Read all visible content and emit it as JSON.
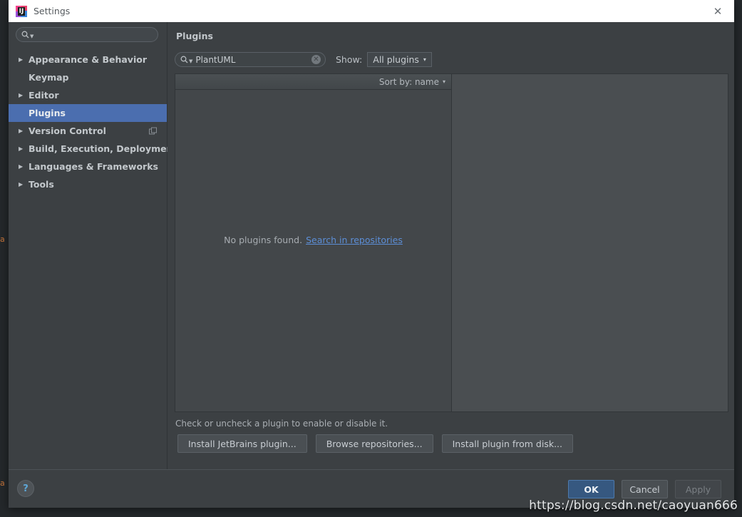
{
  "window": {
    "title": "Settings",
    "app_icon": "intellij-idea-icon",
    "close_label": "✕"
  },
  "sidebar": {
    "search": {
      "value": "",
      "placeholder": "",
      "icon": "search-icon"
    },
    "items": [
      {
        "label": "Appearance & Behavior",
        "expandable": true,
        "selected": false,
        "trailing_icon": ""
      },
      {
        "label": "Keymap",
        "expandable": false,
        "selected": false,
        "trailing_icon": ""
      },
      {
        "label": "Editor",
        "expandable": true,
        "selected": false,
        "trailing_icon": ""
      },
      {
        "label": "Plugins",
        "expandable": false,
        "selected": true,
        "trailing_icon": ""
      },
      {
        "label": "Version Control",
        "expandable": true,
        "selected": false,
        "trailing_icon": "copy-icon"
      },
      {
        "label": "Build, Execution, Deployment",
        "expandable": true,
        "selected": false,
        "trailing_icon": ""
      },
      {
        "label": "Languages & Frameworks",
        "expandable": true,
        "selected": false,
        "trailing_icon": ""
      },
      {
        "label": "Tools",
        "expandable": true,
        "selected": false,
        "trailing_icon": ""
      }
    ]
  },
  "main": {
    "title": "Plugins",
    "plugin_search": {
      "value": "PlantUML",
      "placeholder": "",
      "clear_label": "✕"
    },
    "show": {
      "label": "Show:",
      "value": "All plugins",
      "caret": "▾"
    },
    "sort_by": {
      "label": "Sort by: name",
      "caret": "▾"
    },
    "empty": {
      "message": "No plugins found.",
      "link": "Search in repositories"
    },
    "hint": "Check or uncheck a plugin to enable or disable it.",
    "action_buttons": [
      "Install JetBrains plugin...",
      "Browse repositories...",
      "Install plugin from disk..."
    ]
  },
  "footer": {
    "help_label": "?",
    "buttons": [
      {
        "label": "OK",
        "state": "primary"
      },
      {
        "label": "Cancel",
        "state": "normal"
      },
      {
        "label": "Apply",
        "state": "disabled"
      }
    ]
  },
  "watermark": "https://blog.csdn.net/caoyuan666",
  "edge_text": {
    "a1": "a",
    "a2": "a"
  },
  "colors": {
    "accent": "#4b6eaf",
    "primary_button": "#365880",
    "link": "#5c8ed6",
    "window_bg": "#3c4043",
    "list_bg": "#43474a",
    "detail_bg": "#4a4e51"
  }
}
